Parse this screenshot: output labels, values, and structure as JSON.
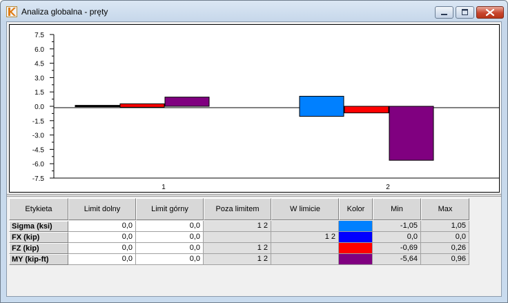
{
  "window": {
    "title": "Analiza globalna - pręty"
  },
  "colors": {
    "blue": "#0080ff",
    "darkblue": "#0000ff",
    "red": "#ff0000",
    "purple": "#800080",
    "black": "#000000"
  },
  "chart_data": {
    "type": "bar",
    "categories": [
      "1",
      "2"
    ],
    "ylim": [
      -7.5,
      7.5
    ],
    "yticks": [
      "7.5",
      "6.0",
      "4.5",
      "3.0",
      "1.5",
      "0.0",
      "-1.5",
      "-3.0",
      "-4.5",
      "-6.0",
      "-7.5"
    ],
    "series": [
      {
        "color": "#000000",
        "values": [
          [
            0.1,
            0.0
          ],
          null
        ]
      },
      {
        "color": "#ff0000",
        "values": [
          [
            0.26,
            -0.1
          ],
          [
            0.0,
            -0.69
          ]
        ]
      },
      {
        "color": "#800080",
        "values": [
          [
            0.96,
            0.0
          ],
          [
            0.0,
            -5.64
          ]
        ]
      },
      {
        "color": "#0080ff",
        "values": [
          null,
          [
            1.05,
            -1.05
          ]
        ]
      }
    ]
  },
  "table": {
    "headers": [
      "Etykieta",
      "Limit dolny",
      "Limit górny",
      "Poza limitem",
      "W limicie",
      "Kolor",
      "Min",
      "Max"
    ],
    "rows": [
      {
        "label": "Sigma (ksi)",
        "lower": "0,0",
        "upper": "0,0",
        "outside": "1 2",
        "inside": "",
        "color": "#0080ff",
        "min": "-1,05",
        "max": "1,05"
      },
      {
        "label": "FX (kip)",
        "lower": "0,0",
        "upper": "0,0",
        "outside": "",
        "inside": "1 2",
        "color": "#0000ff",
        "min": "0,0",
        "max": "0,0"
      },
      {
        "label": "FZ (kip)",
        "lower": "0,0",
        "upper": "0,0",
        "outside": "1 2",
        "inside": "",
        "color": "#ff0000",
        "min": "-0,69",
        "max": "0,26"
      },
      {
        "label": "MY (kip-ft)",
        "lower": "0,0",
        "upper": "0,0",
        "outside": "1 2",
        "inside": "",
        "color": "#800080",
        "min": "-5,64",
        "max": "0,96"
      }
    ]
  }
}
